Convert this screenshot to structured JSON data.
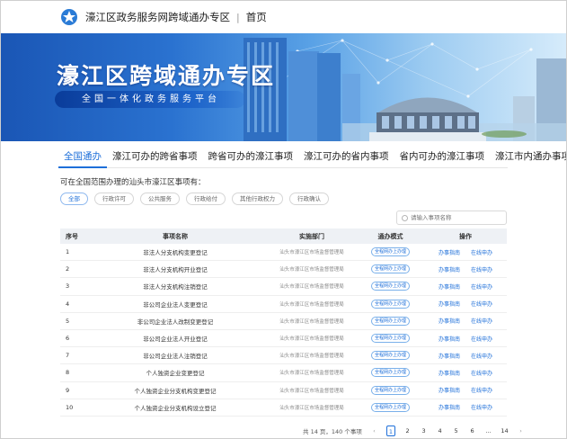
{
  "header": {
    "site_title": "濠江区政务服务网跨域通办专区",
    "separator": "|",
    "home_label": "首页"
  },
  "banner": {
    "title": "濠江区跨域通办专区",
    "subtitle": "全国一体化政务服务平台"
  },
  "tabs": [
    {
      "label": "全国通办",
      "active": true
    },
    {
      "label": "濠江可办的跨省事项",
      "active": false
    },
    {
      "label": "跨省可办的濠江事项",
      "active": false
    },
    {
      "label": "濠江可办的省内事项",
      "active": false
    },
    {
      "label": "省内可办的濠江事项",
      "active": false
    },
    {
      "label": "濠江市内通办事项",
      "active": false
    }
  ],
  "hint": "可在全国范围办理的汕头市濠江区事项有：",
  "filters": [
    {
      "label": "全部",
      "active": true
    },
    {
      "label": "行政许可",
      "active": false
    },
    {
      "label": "公共服务",
      "active": false
    },
    {
      "label": "行政给付",
      "active": false
    },
    {
      "label": "其他行政权力",
      "active": false
    },
    {
      "label": "行政确认",
      "active": false
    }
  ],
  "search": {
    "placeholder": "请输入事项名称"
  },
  "table": {
    "headers": {
      "no": "序号",
      "name": "事项名称",
      "dept": "实施部门",
      "mode": "通办模式",
      "ops": "操作"
    },
    "rows": [
      {
        "no": "1",
        "name": "非法人分支机构变更登记",
        "dept": "汕头市濠江区市场监督管理局",
        "mode": "全程网办上办理",
        "guide": "办事指南",
        "apply": "在线申办"
      },
      {
        "no": "2",
        "name": "非法人分支机构开业登记",
        "dept": "汕头市濠江区市场监督管理局",
        "mode": "全程网办上办理",
        "guide": "办事指南",
        "apply": "在线申办"
      },
      {
        "no": "3",
        "name": "非法人分支机构注销登记",
        "dept": "汕头市濠江区市场监督管理局",
        "mode": "全程网办上办理",
        "guide": "办事指南",
        "apply": "在线申办"
      },
      {
        "no": "4",
        "name": "非公司企业法人变更登记",
        "dept": "汕头市濠江区市场监督管理局",
        "mode": "全程网办上办理",
        "guide": "办事指南",
        "apply": "在线申办"
      },
      {
        "no": "5",
        "name": "非公司企业法人改制变更登记",
        "dept": "汕头市濠江区市场监督管理局",
        "mode": "全程网办上办理",
        "guide": "办事指南",
        "apply": "在线申办"
      },
      {
        "no": "6",
        "name": "非公司企业法人开业登记",
        "dept": "汕头市濠江区市场监督管理局",
        "mode": "全程网办上办理",
        "guide": "办事指南",
        "apply": "在线申办"
      },
      {
        "no": "7",
        "name": "非公司企业法人注销登记",
        "dept": "汕头市濠江区市场监督管理局",
        "mode": "全程网办上办理",
        "guide": "办事指南",
        "apply": "在线申办"
      },
      {
        "no": "8",
        "name": "个人独资企业变更登记",
        "dept": "汕头市濠江区市场监督管理局",
        "mode": "全程网办上办理",
        "guide": "办事指南",
        "apply": "在线申办"
      },
      {
        "no": "9",
        "name": "个人独资企业分支机构变更登记",
        "dept": "汕头市濠江区市场监督管理局",
        "mode": "全程网办上办理",
        "guide": "办事指南",
        "apply": "在线申办"
      },
      {
        "no": "10",
        "name": "个人独资企业分支机构设立登记",
        "dept": "汕头市濠江区市场监督管理局",
        "mode": "全程网办上办理",
        "guide": "办事指南",
        "apply": "在线申办"
      }
    ]
  },
  "pagination": {
    "summary": "共 14 页，140 个事项",
    "prev": "‹",
    "pages": [
      "1",
      "2",
      "3",
      "4",
      "5",
      "6",
      "...",
      "14"
    ],
    "current": "1",
    "next": "›"
  },
  "colors": {
    "accent": "#1e6fd9",
    "header_row": "#eef1f5",
    "banner_dark": "#1a56b5"
  },
  "icons": {
    "logo": "government-emblem-icon",
    "search": "search-icon"
  }
}
